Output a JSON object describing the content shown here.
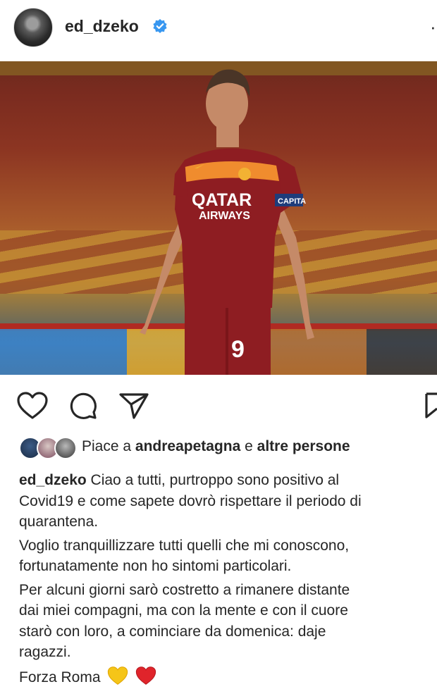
{
  "post": {
    "username": "ed_dzeko",
    "verified": true,
    "photo": {
      "jersey_sponsor_line1": "QATAR",
      "jersey_sponsor_line2": "AIRWAYS",
      "jersey_number": "9",
      "armband": "CAPITA"
    }
  },
  "actions": {
    "like_icon": "heart-outline-icon",
    "comment_icon": "comment-bubble-icon",
    "share_icon": "paper-plane-icon",
    "save_icon": "bookmark-icon"
  },
  "likes": {
    "prefix": "Piace a",
    "user": "andreapetagna",
    "connector": "e",
    "others": "altre persone"
  },
  "caption": {
    "username": "ed_dzeko",
    "lines": [
      "Ciao a tutti, purtroppo sono positivo al",
      "Covid19 e come sapete dovrò rispettare il periodo di",
      "quarantena.",
      "Voglio tranquillizzare tutti quelli che mi conoscono,",
      "fortunatamente non ho sintomi particolari.",
      "Per alcuni giorni sarò costretto a rimanere distante",
      "dai miei compagni, ma con la mente e con il cuore",
      "starò con loro, a cominciare da domenica: daje",
      "ragazzi.",
      "Forza Roma"
    ]
  },
  "colors": {
    "verified_blue": "#3897f0",
    "heart_red": "#e0242b",
    "heart_yellow": "#f5c518",
    "jersey_red": "#8e1d22"
  }
}
